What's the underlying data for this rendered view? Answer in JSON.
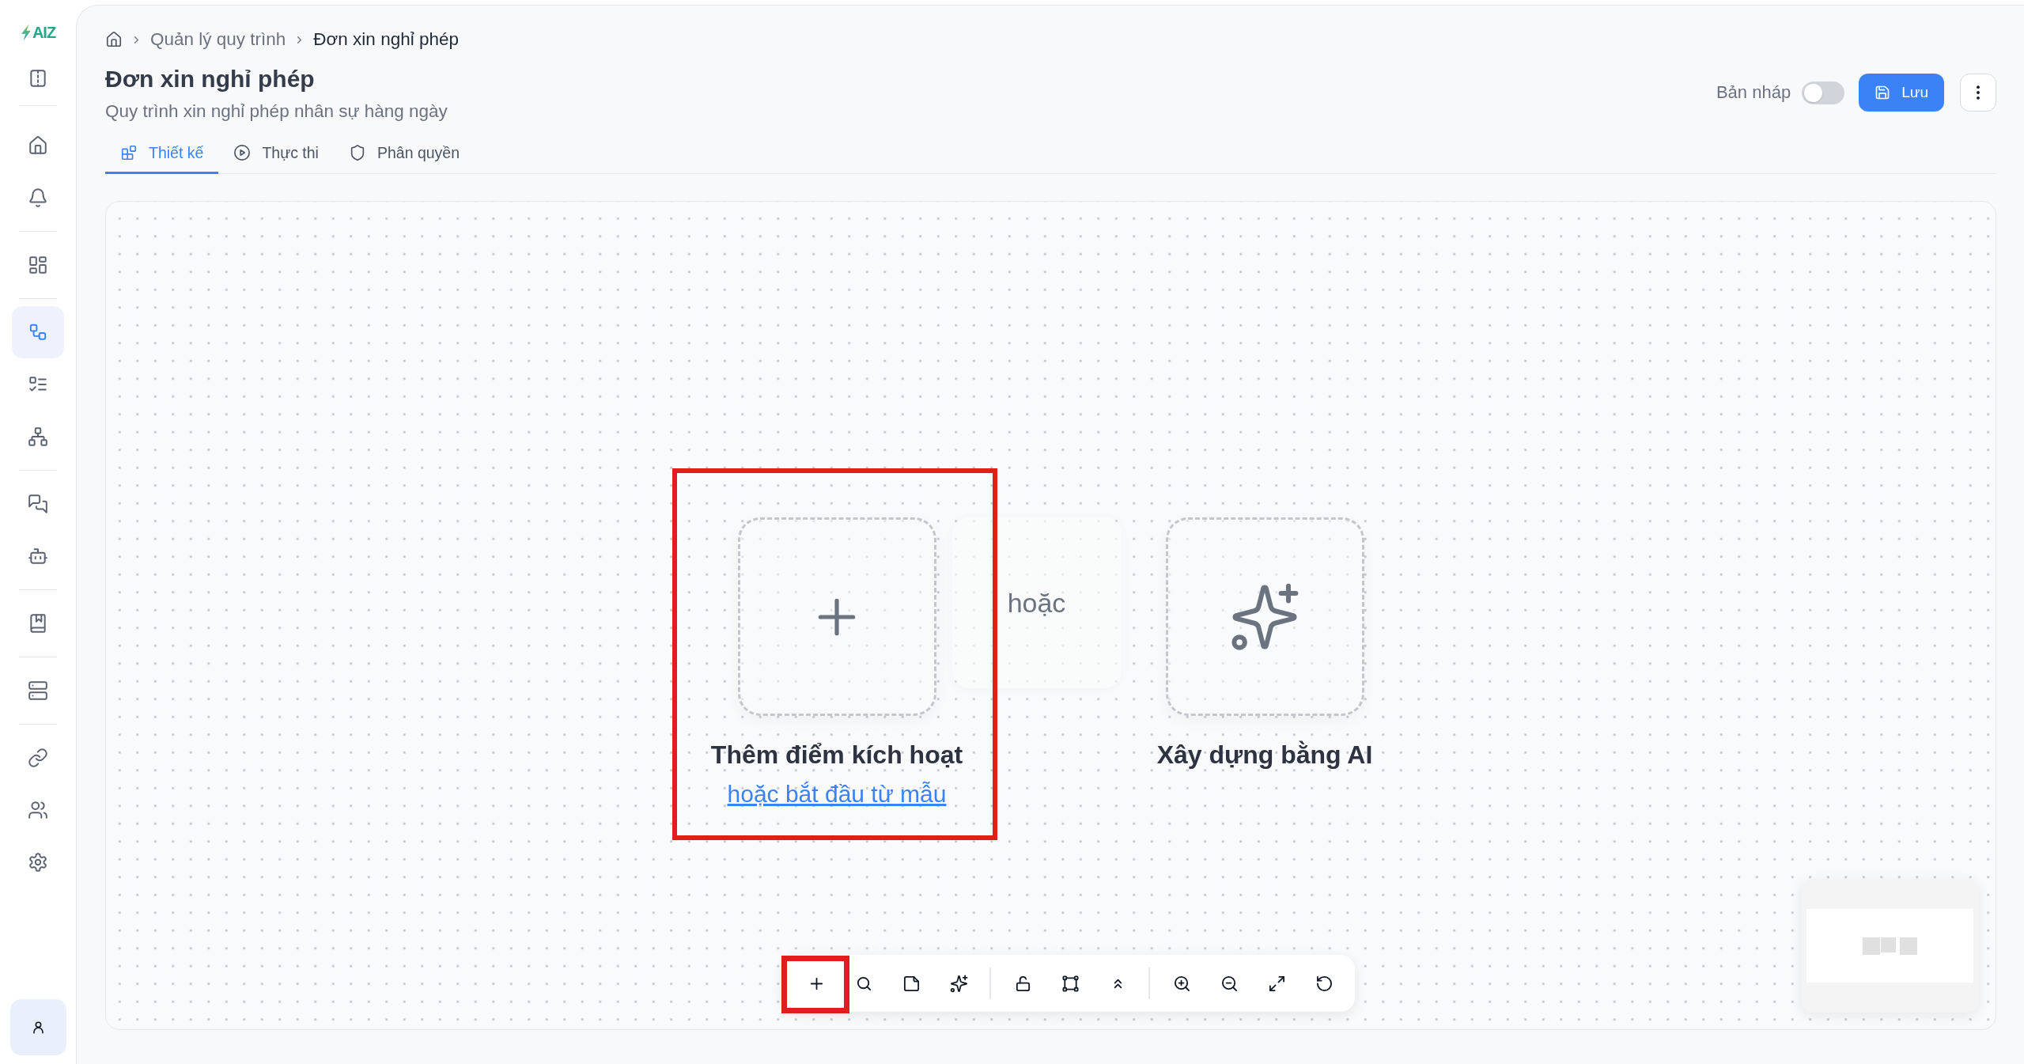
{
  "sidebar": {
    "logo": "AIZ",
    "groups": [
      {
        "items": [
          {
            "selected": false
          },
          {
            "selected": false
          }
        ]
      },
      {
        "items": [
          {
            "selected": false
          }
        ]
      },
      {
        "items": [
          {
            "selected": true
          },
          {
            "selected": false
          },
          {
            "selected": false
          }
        ]
      },
      {
        "items": [
          {
            "selected": false
          },
          {
            "selected": false
          }
        ]
      },
      {
        "items": [
          {
            "selected": false
          }
        ]
      },
      {
        "items": [
          {
            "selected": false
          }
        ]
      },
      {
        "items": [
          {
            "selected": false
          },
          {
            "selected": false
          },
          {
            "selected": false
          }
        ]
      }
    ]
  },
  "breadcrumb": [
    {
      "label": "Quản lý quy trình",
      "current": false
    },
    {
      "label": "Đơn xin nghỉ phép",
      "current": true
    }
  ],
  "title": "Đơn xin nghỉ phép",
  "subtitle": "Quy trình xin nghỉ phép nhân sự hàng ngày",
  "draft": {
    "label": "Bản nháp",
    "on": false
  },
  "save_button": "Lưu",
  "tabs": [
    {
      "label": "Thiết kế",
      "selected": true
    },
    {
      "label": "Thực thi",
      "selected": false
    },
    {
      "label": "Phân quyền",
      "selected": false
    }
  ],
  "canvas": {
    "trigger": {
      "title": "Thêm điểm kích hoạt",
      "link": "hoặc bắt đầu từ mẫu",
      "highlighted": true
    },
    "separator": "hoặc",
    "ai": {
      "title": "Xây dựng bằng AI"
    }
  },
  "toolbar": {
    "groups": [
      {
        "buttons": [
          {
            "highlighted": true
          },
          {
            "highlighted": false
          },
          {
            "highlighted": false
          },
          {
            "highlighted": false
          }
        ]
      },
      {
        "buttons": [
          {
            "highlighted": false
          },
          {
            "highlighted": false
          },
          {
            "highlighted": false
          }
        ]
      },
      {
        "buttons": [
          {
            "highlighted": false
          },
          {
            "highlighted": false
          },
          {
            "highlighted": false
          },
          {
            "highlighted": false
          }
        ]
      }
    ]
  }
}
